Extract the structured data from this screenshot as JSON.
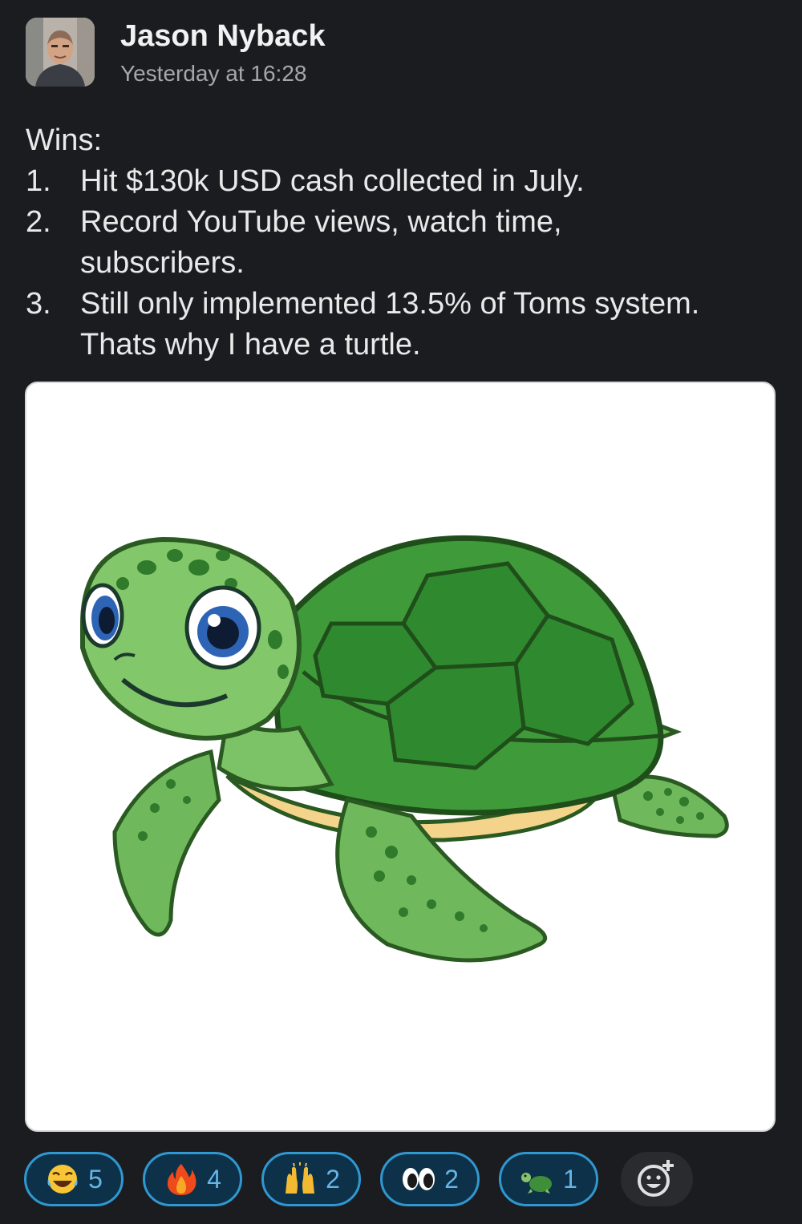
{
  "post": {
    "author": "Jason Nyback",
    "timestamp": "Yesterday at 16:28",
    "avatar_icon": "profile-photo"
  },
  "message": {
    "heading": "Wins:",
    "items": [
      {
        "num": "1.",
        "lines": [
          "Hit $130k USD cash collected in July."
        ]
      },
      {
        "num": "2.",
        "lines": [
          "Record YouTube views, watch time,",
          "subscribers."
        ]
      },
      {
        "num": "3.",
        "lines": [
          "Still only implemented 13.5% of Toms system.",
          "Thats why I have a turtle."
        ]
      }
    ]
  },
  "attachment": {
    "icon": "turtle-illustration"
  },
  "reactions": [
    {
      "emoji": "laughing-tears",
      "count": "5"
    },
    {
      "emoji": "fire",
      "count": "4"
    },
    {
      "emoji": "raised-hands",
      "count": "2"
    },
    {
      "emoji": "eyes",
      "count": "2"
    },
    {
      "emoji": "turtle",
      "count": "1"
    }
  ],
  "add_reaction_icon": "add-reaction-icon",
  "colors": {
    "background": "#1b1c20",
    "reaction_border": "#2f98d1",
    "reaction_bg": "#0d3149",
    "reaction_count": "#64b6e6"
  }
}
